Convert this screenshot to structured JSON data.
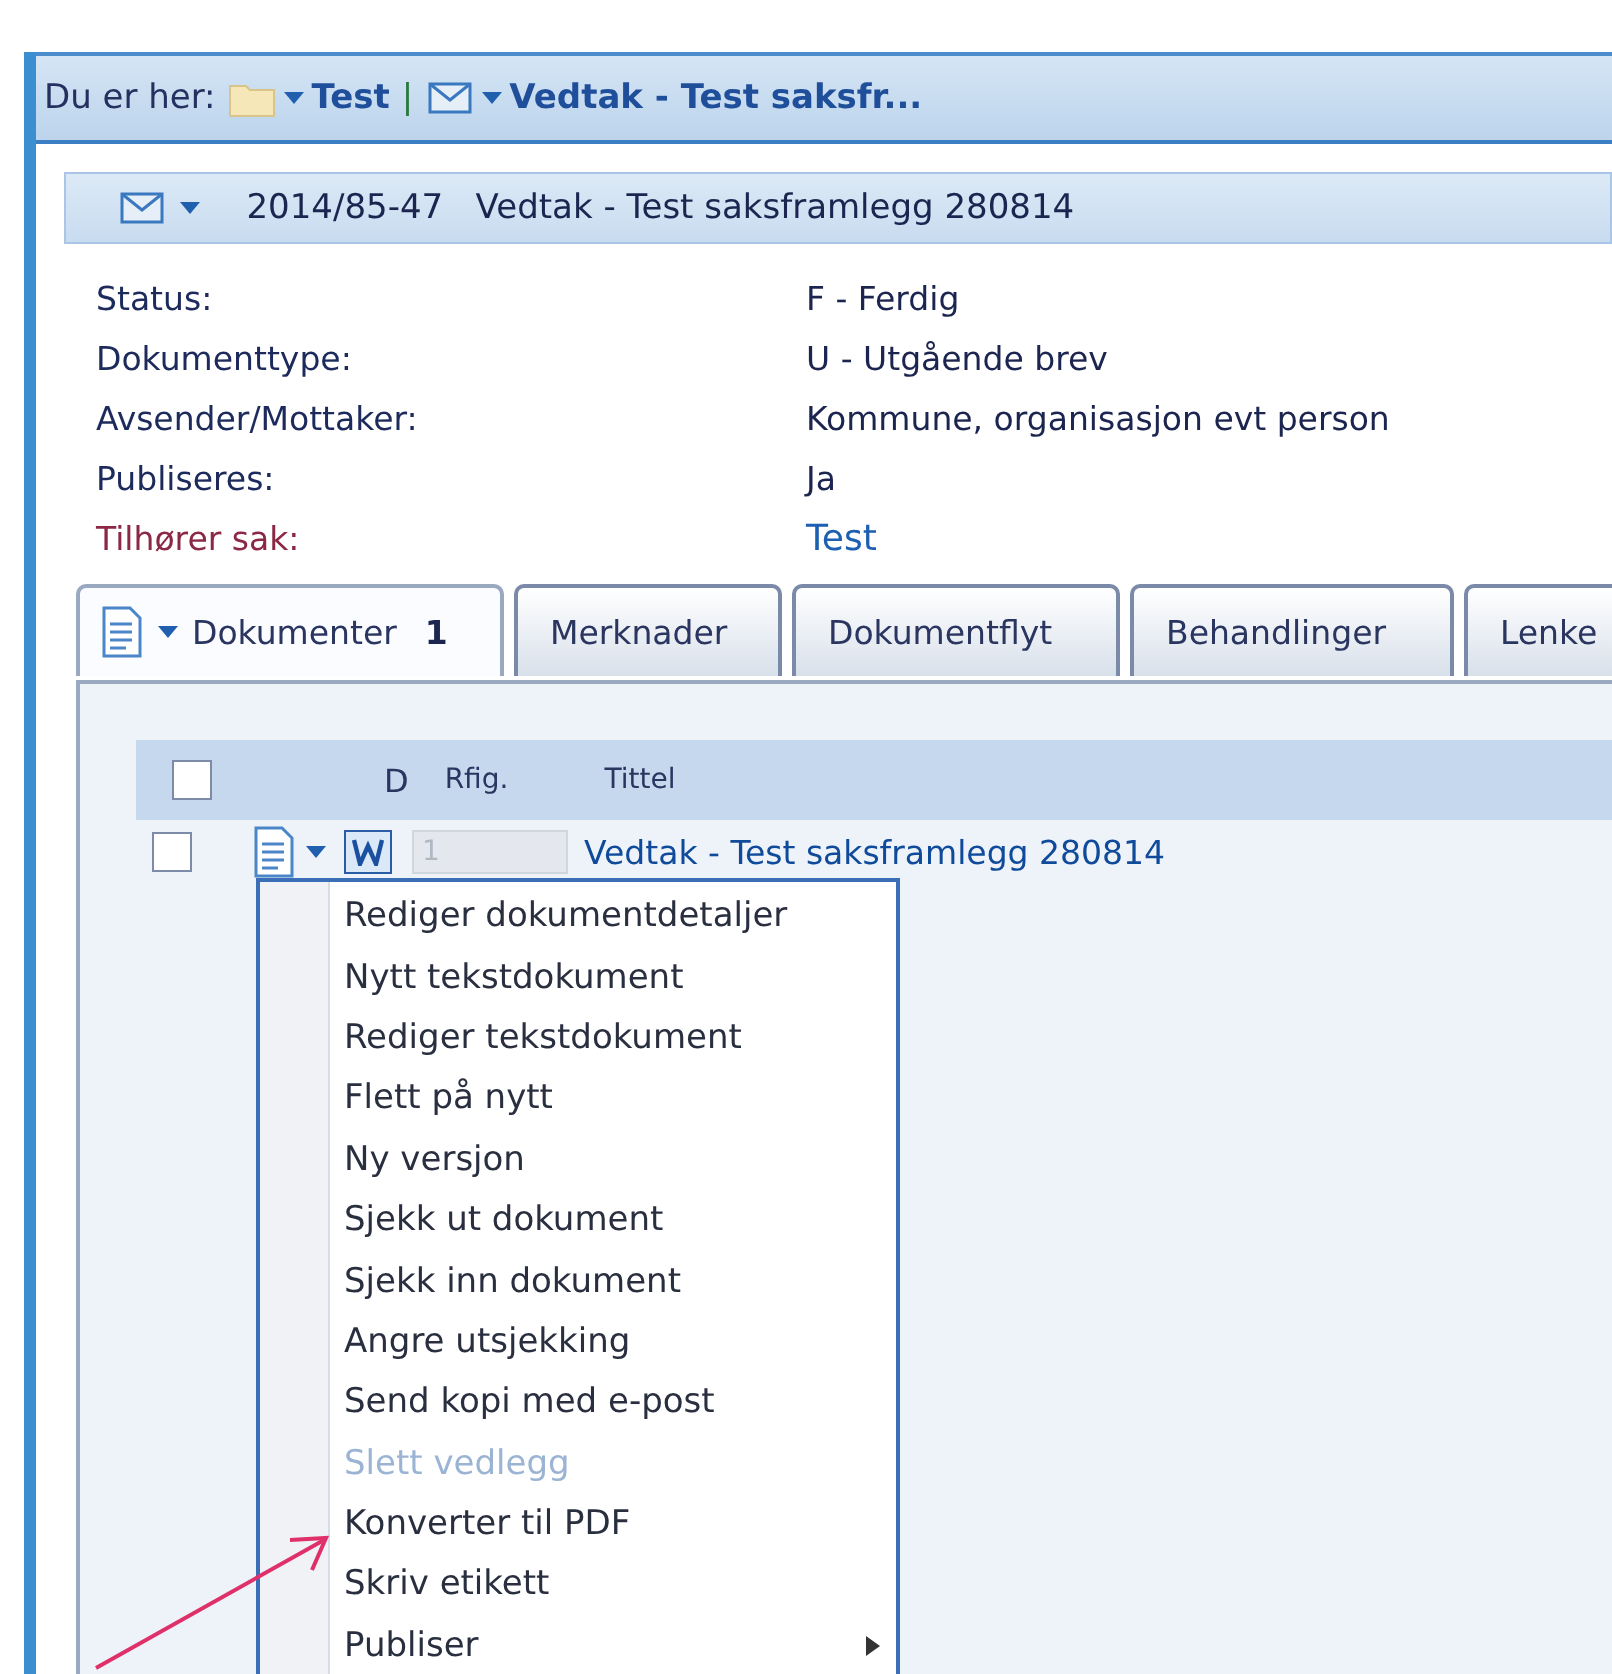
{
  "breadcrumb": {
    "label": "Du er her:",
    "items": [
      {
        "kind": "folder",
        "text": "Test"
      },
      {
        "kind": "letter",
        "text": "Vedtak - Test saksfr..."
      }
    ],
    "separator": "|"
  },
  "record": {
    "title": "2014/85-47   Vedtak - Test saksframlegg 280814",
    "fields": [
      {
        "kind": "text",
        "label": "Status:",
        "value": "F - Ferdig"
      },
      {
        "kind": "text",
        "label": "Dokumenttype:",
        "value": "U - Utgående brev"
      },
      {
        "kind": "text",
        "label": "Avsender/Mottaker:",
        "value": "Kommune, organisasjon evt person"
      },
      {
        "kind": "text",
        "label": "Publiseres:",
        "value": "Ja"
      },
      {
        "kind": "link",
        "label": "Tilhører sak:",
        "value": "Test"
      }
    ]
  },
  "tabs": [
    {
      "label": "Dokumenter",
      "count": "1",
      "selected": true
    },
    {
      "label": "Merknader",
      "selected": false
    },
    {
      "label": "Dokumentflyt",
      "selected": false
    },
    {
      "label": "Behandlinger",
      "selected": false
    },
    {
      "label": "Lenke",
      "selected": false
    }
  ],
  "table": {
    "all_checked": false,
    "columns": [
      "D",
      "Rfig.",
      "Tittel"
    ],
    "rows": [
      {
        "checked": false,
        "rfig": "1",
        "title": "Vedtak - Test saksframlegg 280814"
      }
    ]
  },
  "context_menu": [
    {
      "label": "Rediger dokumentdetaljer",
      "disabled": false,
      "submenu": false
    },
    {
      "label": "Nytt tekstdokument",
      "disabled": false,
      "submenu": false
    },
    {
      "label": "Rediger tekstdokument",
      "disabled": false,
      "submenu": false
    },
    {
      "label": "Flett på nytt",
      "disabled": false,
      "submenu": false
    },
    {
      "label": "Ny versjon",
      "disabled": false,
      "submenu": false
    },
    {
      "label": "Sjekk ut dokument",
      "disabled": false,
      "submenu": false
    },
    {
      "label": "Sjekk inn dokument",
      "disabled": false,
      "submenu": false
    },
    {
      "label": "Angre utsjekking",
      "disabled": false,
      "submenu": false
    },
    {
      "label": "Send kopi med e-post",
      "disabled": false,
      "submenu": false
    },
    {
      "label": "Slett vedlegg",
      "disabled": true,
      "submenu": false
    },
    {
      "label": "Konverter til PDF",
      "disabled": false,
      "submenu": false
    },
    {
      "label": "Skriv etikett",
      "disabled": false,
      "submenu": false
    },
    {
      "label": "Publiser",
      "disabled": false,
      "submenu": true
    }
  ]
}
